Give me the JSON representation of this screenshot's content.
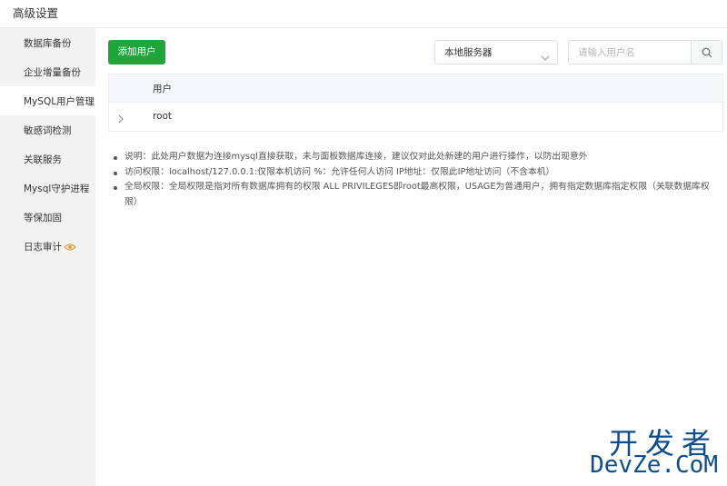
{
  "header": {
    "title": "高级设置"
  },
  "sidebar": {
    "items": [
      {
        "label": "数据库备份"
      },
      {
        "label": "企业增量备份"
      },
      {
        "label": "MySQL用户管理"
      },
      {
        "label": "敏感词检测"
      },
      {
        "label": "关联服务"
      },
      {
        "label": "Mysql守护进程"
      },
      {
        "label": "等保加固"
      },
      {
        "label": "日志审计"
      }
    ],
    "active_index": 2,
    "badge_icon": "eye-icon"
  },
  "toolbar": {
    "add_user_label": "添加用户",
    "server_select": {
      "value": "本地服务器"
    },
    "search": {
      "placeholder": "请输入用户名",
      "value": ""
    }
  },
  "table": {
    "columns": [
      "用户"
    ],
    "rows": [
      {
        "user": "root"
      }
    ]
  },
  "notes": [
    "说明：此处用户数据为连接mysql直接获取，未与面板数据库连接，建议仅对此处新建的用户进行操作，以防出现意外",
    "访问权限：localhost/127.0.0.1:仅限本机访问 %：允许任何人访问 IP地址：仅限此IP地址访问（不含本机）",
    "全局权限：全局权限是指对所有数据库拥有的权限 ALL PRIVILEGES即root最高权限，USAGE为普通用户，拥有指定数据库指定权限（关联数据库权限）"
  ],
  "watermark": {
    "cn": "开发者",
    "en": "DevZe.CoM"
  },
  "colors": {
    "accent": "#20a53a",
    "watermark": "#0d4d8f"
  }
}
